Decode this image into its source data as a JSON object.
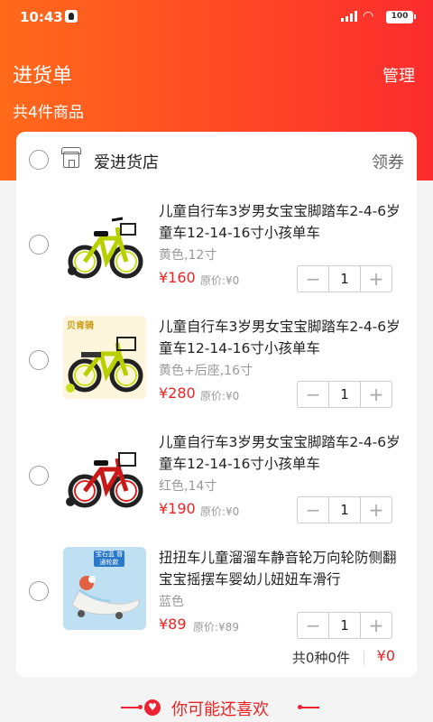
{
  "status_bar": {
    "time": "10:43",
    "battery": "100"
  },
  "header": {
    "title": "进货单",
    "manage_label": "管理",
    "item_count": "共4件商品"
  },
  "shop": {
    "name": "爱进货店",
    "coupon_label": "领券"
  },
  "items": [
    {
      "name": "儿童自行车3岁男女宝宝脚踏车2-4-6岁童车12-14-16寸小孩单车",
      "spec": "黄色,12寸",
      "price": "¥160",
      "original": "原价:¥0",
      "qty": "1"
    },
    {
      "name": "儿童自行车3岁男女宝宝脚踏车2-4-6岁童车12-14-16寸小孩单车",
      "spec": "黄色+后座,16寸",
      "price": "¥280",
      "original": "原价:¥0",
      "qty": "1",
      "image_badge": "贝肯骑"
    },
    {
      "name": "儿童自行车3岁男女宝宝脚踏车2-4-6岁童车12-14-16寸小孩单车",
      "spec": "红色,14寸",
      "price": "¥190",
      "original": "原价:¥0",
      "qty": "1"
    },
    {
      "name": "扭扭车儿童溜溜车静音轮万向轮防侧翻宝宝摇摆车婴幼儿妞妞车滑行",
      "spec": "蓝色",
      "price": "¥89",
      "original": "原价:¥89",
      "qty": "1",
      "image_badge": "宝石蓝 普通轮款"
    }
  ],
  "stepper": {
    "minus": "−",
    "plus": "+"
  },
  "summary": {
    "text": "共0种0件",
    "total": "¥0"
  },
  "recommend": {
    "title": "你可能还喜欢"
  },
  "colors": {
    "accent": "#ff4526",
    "price": "#e22222",
    "header_start": "#ff6a1a",
    "header_end": "#fb2c2e"
  }
}
